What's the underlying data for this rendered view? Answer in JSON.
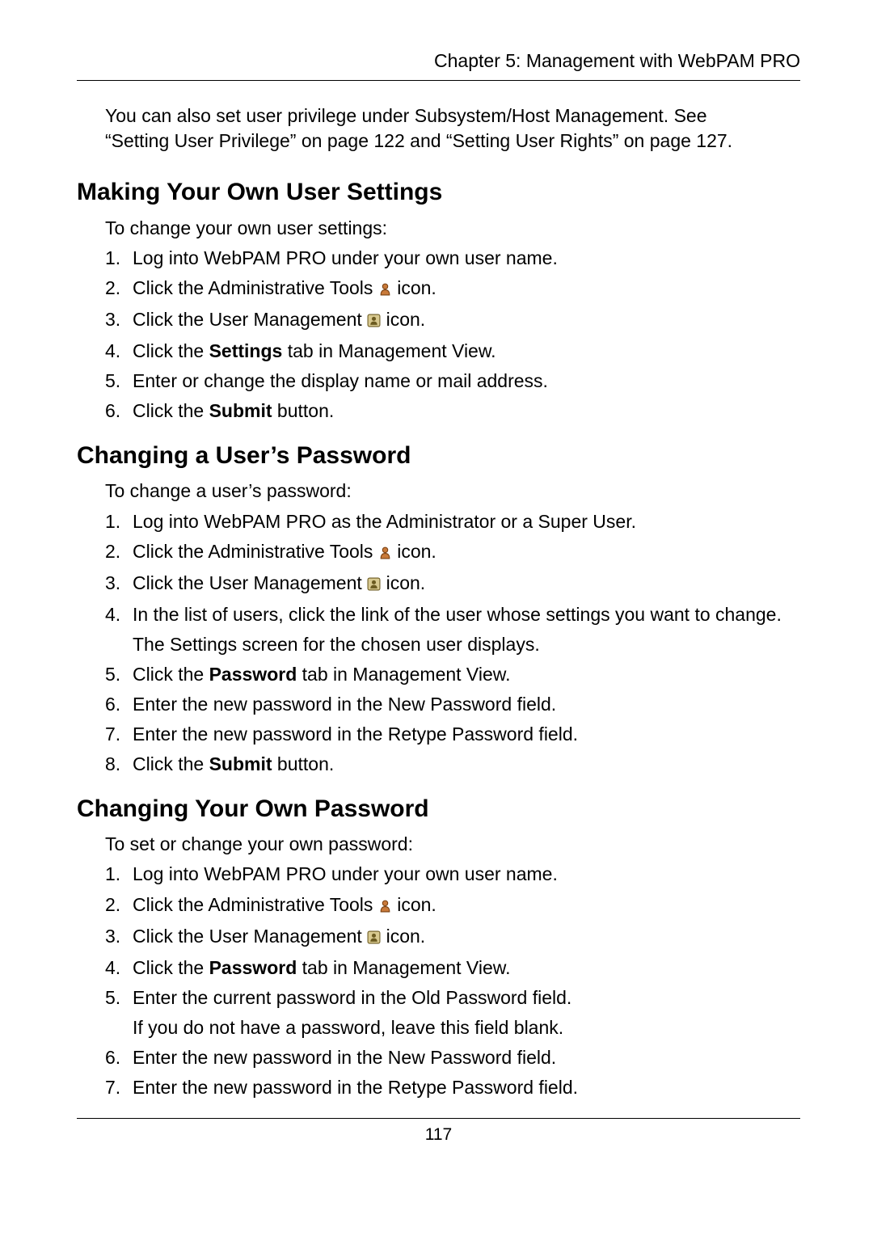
{
  "header": {
    "chapter": "Chapter 5: Management with WebPAM PRO"
  },
  "intro": {
    "line1": "You can also set user privilege under Subsystem/Host Management. See",
    "line2": "“Setting User Privilege” on page 122 and “Setting User Rights” on page 127."
  },
  "section1": {
    "title": "Making Your Own User Settings",
    "lead": "To change your own user settings:",
    "steps": {
      "s1": "Log into WebPAM PRO under your own user name.",
      "s2a": "Click the Administrative Tools ",
      "s2b": " icon.",
      "s3a": "Click the User Management ",
      "s3b": " icon.",
      "s4a": "Click the ",
      "s4bold": "Settings",
      "s4b": " tab in Management View.",
      "s5": "Enter or change the display name or mail address.",
      "s6a": "Click the ",
      "s6bold": "Submit",
      "s6b": " button."
    }
  },
  "section2": {
    "title": "Changing a User’s Password",
    "lead": "To change a user’s password:",
    "steps": {
      "s1": "Log into WebPAM PRO as the Administrator or a Super User.",
      "s2a": "Click the Administrative Tools ",
      "s2b": " icon.",
      "s3a": "Click the User Management ",
      "s3b": " icon.",
      "s4a": "In the list of users, click the link of the user whose settings you want to change.",
      "s4sub": "The Settings screen for the chosen user displays.",
      "s5a": "Click the ",
      "s5bold": "Password",
      "s5b": " tab in Management View.",
      "s6": "Enter the new password in the New Password field.",
      "s7": "Enter the new password in the Retype Password field.",
      "s8a": "Click the ",
      "s8bold": "Submit",
      "s8b": " button."
    }
  },
  "section3": {
    "title": "Changing Your Own Password",
    "lead": "To set or change your own password:",
    "steps": {
      "s1": "Log into WebPAM PRO under your own user name.",
      "s2a": "Click the Administrative Tools ",
      "s2b": " icon.",
      "s3a": "Click the User Management ",
      "s3b": " icon.",
      "s4a": "Click the ",
      "s4bold": "Password",
      "s4b": " tab in Management View.",
      "s5a": "Enter the current password in the Old Password field.",
      "s5sub": "If you do not have a password, leave this field blank.",
      "s6": "Enter the new password in the New Password field.",
      "s7": "Enter the new password in the Retype Password field."
    }
  },
  "nums": {
    "n1": "1.",
    "n2": "2.",
    "n3": "3.",
    "n4": "4.",
    "n5": "5.",
    "n6": "6.",
    "n7": "7.",
    "n8": "8."
  },
  "page_number": "117"
}
